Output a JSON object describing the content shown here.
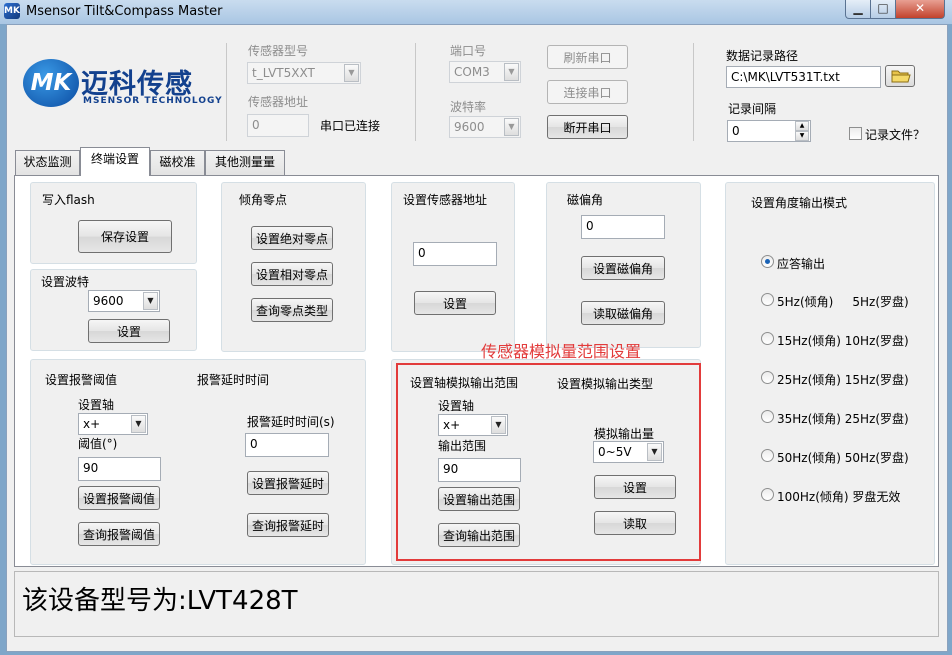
{
  "window": {
    "title": "Msensor Tilt&Compass Master",
    "icon_label": "MK",
    "min_glyph": "▁",
    "max_glyph": "□",
    "close_glyph": "✕"
  },
  "logo": {
    "mark": "MK",
    "cn": "迈科传感",
    "en": "MSENSOR TECHNOLOGY"
  },
  "connection": {
    "sensor_model_label": "传感器型号",
    "sensor_model_value": "t_LVT5XXT",
    "sensor_address_label": "传感器地址",
    "sensor_address_value": "0",
    "connected_status": "串口已连接",
    "port_label": "端口号",
    "port_value": "COM3",
    "baud_label": "波特率",
    "baud_value": "9600",
    "refresh_button": "刷新串口",
    "connect_button": "连接串口",
    "disconnect_button": "断开串口"
  },
  "logging": {
    "path_label": "数据记录路径",
    "path_value": "C:\\MK\\LVT531T.txt",
    "interval_label": "记录间隔",
    "interval_value": "0",
    "record_file_label": "记录文件？"
  },
  "tabs": [
    "状态监测",
    "终端设置",
    "磁校准",
    "其他测量量"
  ],
  "flash": {
    "title": "写入flash",
    "save_button": "保存设置"
  },
  "baud_group": {
    "title": "设置波特",
    "value": "9600",
    "set_button": "设置"
  },
  "tilt_zero": {
    "title": "倾角零点",
    "abs_button": "设置绝对零点",
    "rel_button": "设置相对零点",
    "query_button": "查询零点类型"
  },
  "sensor_addr_group": {
    "title": "设置传感器地址",
    "value": "0",
    "set_button": "设置"
  },
  "declination": {
    "title": "磁偏角",
    "value": "0",
    "set_button": "设置磁偏角",
    "read_button": "读取磁偏角"
  },
  "output_mode": {
    "title": "设置角度输出模式",
    "options": [
      "应答输出",
      "5Hz(倾角)     5Hz(罗盘)",
      "15Hz(倾角) 10Hz(罗盘)",
      "25Hz(倾角) 15Hz(罗盘)",
      "35Hz(倾角) 25Hz(罗盘)",
      "50Hz(倾角) 50Hz(罗盘)",
      "100Hz(倾角) 罗盘无效"
    ],
    "selected_index": 0
  },
  "alarm": {
    "title": "设置报警阈值",
    "axis_label": "设置轴",
    "axis_value": "x+",
    "threshold_label": "阈值(°)",
    "threshold_value": "90",
    "set_button": "设置报警阈值",
    "query_button": "查询报警阈值"
  },
  "alarm_delay": {
    "title": "报警延时时间",
    "delay_label": "报警延时时间(s)",
    "delay_value": "0",
    "set_button": "设置报警延时",
    "query_button": "查询报警延时"
  },
  "analog": {
    "annotation": "传感器模拟量范围设置",
    "range_title": "设置轴模拟输出范围",
    "axis_label": "设置轴",
    "axis_value": "x+",
    "range_label": "输出范围",
    "range_value": "90",
    "set_range_button": "设置输出范围",
    "query_range_button": "查询输出范围",
    "type_title": "设置模拟输出类型",
    "type_label": "模拟输出量",
    "type_value": "0~5V",
    "set_button": "设置",
    "read_button": "读取"
  },
  "status": {
    "text": "该设备型号为:LVT428T"
  },
  "glyphs": {
    "dropdown": "▼",
    "spin_up": "▲",
    "spin_down": "▼",
    "folder": "folder-icon"
  },
  "colors": {
    "annotation_red": "#e23b3b",
    "logo_blue": "#13418e"
  }
}
